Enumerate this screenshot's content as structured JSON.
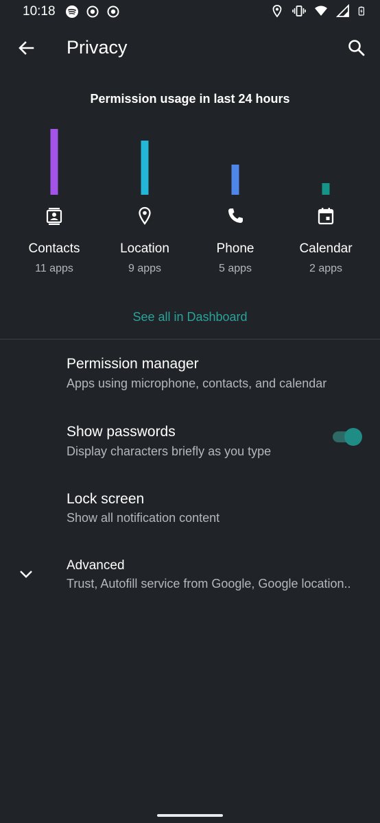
{
  "status_bar": {
    "time": "10:18"
  },
  "app_bar": {
    "title": "Privacy"
  },
  "usage": {
    "title": "Permission usage in last 24 hours",
    "items": [
      {
        "label": "Contacts",
        "count": "11 apps",
        "apps": 11,
        "color": "#a354e8",
        "icon": "contacts-icon"
      },
      {
        "label": "Location",
        "count": "9 apps",
        "apps": 9,
        "color": "#24b6d6",
        "icon": "location-pin-icon"
      },
      {
        "label": "Phone",
        "count": "5 apps",
        "apps": 5,
        "color": "#4f86ea",
        "icon": "phone-icon"
      },
      {
        "label": "Calendar",
        "count": "2 apps",
        "apps": 2,
        "color": "#159488",
        "icon": "calendar-icon"
      }
    ],
    "dashboard_link": "See all in Dashboard"
  },
  "settings": {
    "permission_manager": {
      "title": "Permission manager",
      "subtitle": "Apps using microphone, contacts, and calendar"
    },
    "show_passwords": {
      "title": "Show passwords",
      "subtitle": "Display characters briefly as you type",
      "enabled": true
    },
    "lock_screen": {
      "title": "Lock screen",
      "subtitle": "Show all notification content"
    },
    "advanced": {
      "title": "Advanced",
      "subtitle": "Trust, Autofill service from Google, Google location.."
    }
  },
  "colors": {
    "background": "#202327",
    "accent": "#2aa39a"
  }
}
